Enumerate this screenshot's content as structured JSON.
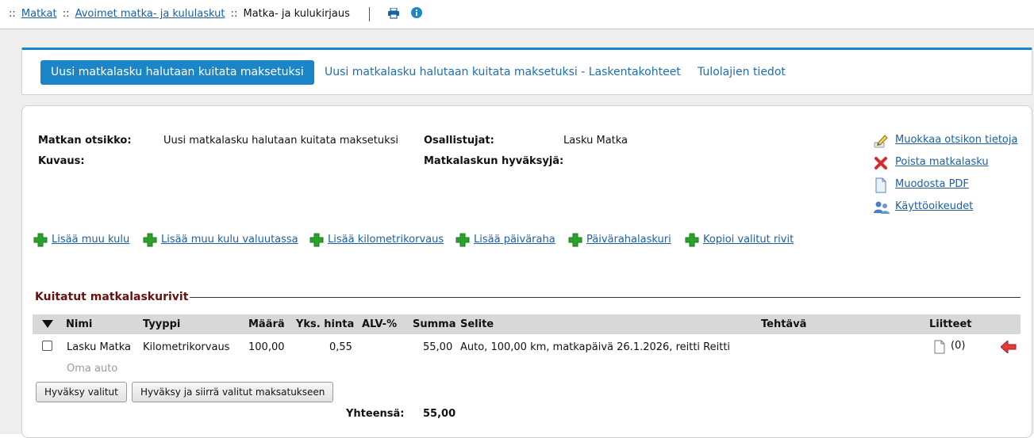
{
  "breadcrumb": {
    "prefix": "::",
    "items": [
      "Matkat",
      "Avoimet matka- ja kululaskut"
    ],
    "current": "Matka- ja kulukirjaus",
    "icons": [
      "printer-icon",
      "info-icon"
    ]
  },
  "tabs": [
    {
      "label": "Uusi matkalasku halutaan kuitata maksetuksi",
      "active": true
    },
    {
      "label": "Uusi matkalasku halutaan kuitata maksetuksi - Laskentakohteet",
      "active": false
    },
    {
      "label": "Tulolajien tiedot",
      "active": false
    }
  ],
  "header": {
    "trip_title_label": "Matkan otsikko:",
    "trip_title_value": "Uusi matkalasku halutaan kuitata maksetuksi",
    "description_label": "Kuvaus:",
    "participants_label": "Osallistujat:",
    "participants_value": "Lasku Matka",
    "approver_label": "Matkalaskun hyväksyjä:"
  },
  "actions": [
    {
      "label": "Muokkaa otsikon tietoja",
      "icon": "pencil-icon"
    },
    {
      "label": "Poista matkalasku",
      "icon": "delete-icon"
    },
    {
      "label": "Muodosta PDF",
      "icon": "document-icon"
    },
    {
      "label": "Käyttöoikeudet",
      "icon": "users-icon"
    }
  ],
  "add_links": [
    "Lisää muu kulu",
    "Lisää muu kulu valuutassa",
    "Lisää kilometrikorvaus",
    "Lisää päiväraha",
    "Päivärahalaskuri",
    "Kopioi valitut rivit"
  ],
  "section": {
    "title": "Kuitatut matkalaskurivit"
  },
  "table": {
    "columns": [
      "Nimi",
      "Tyyppi",
      "Määrä",
      "Yks. hinta",
      "ALV-%",
      "Summa",
      "Selite",
      "Tehtävä",
      "Liitteet"
    ],
    "rows": [
      {
        "name": "Lasku Matka",
        "subtitle": "Oma auto",
        "type": "Kilometrikorvaus",
        "quantity": "100,00",
        "unit_price": "0,55",
        "vat": "",
        "sum": "55,00",
        "description": "Auto, 100,00 km, matkapäivä 26.1.2026, reitti Reitti",
        "task": "",
        "attachments": "(0)",
        "checked": false
      }
    ]
  },
  "buttons": {
    "approve": "Hyväksy valitut",
    "approve_and_move": "Hyväksy ja siirrä valitut maksatukseen"
  },
  "totals": {
    "label": "Yhteensä:",
    "value": "55,00"
  },
  "colors": {
    "accent": "#1a86c8",
    "link": "#1a5fa8",
    "section_title": "#6b1010",
    "add_icon": "#2aa12a",
    "delete_icon": "#d92b2b",
    "row_arrow": "#e23b3b"
  }
}
